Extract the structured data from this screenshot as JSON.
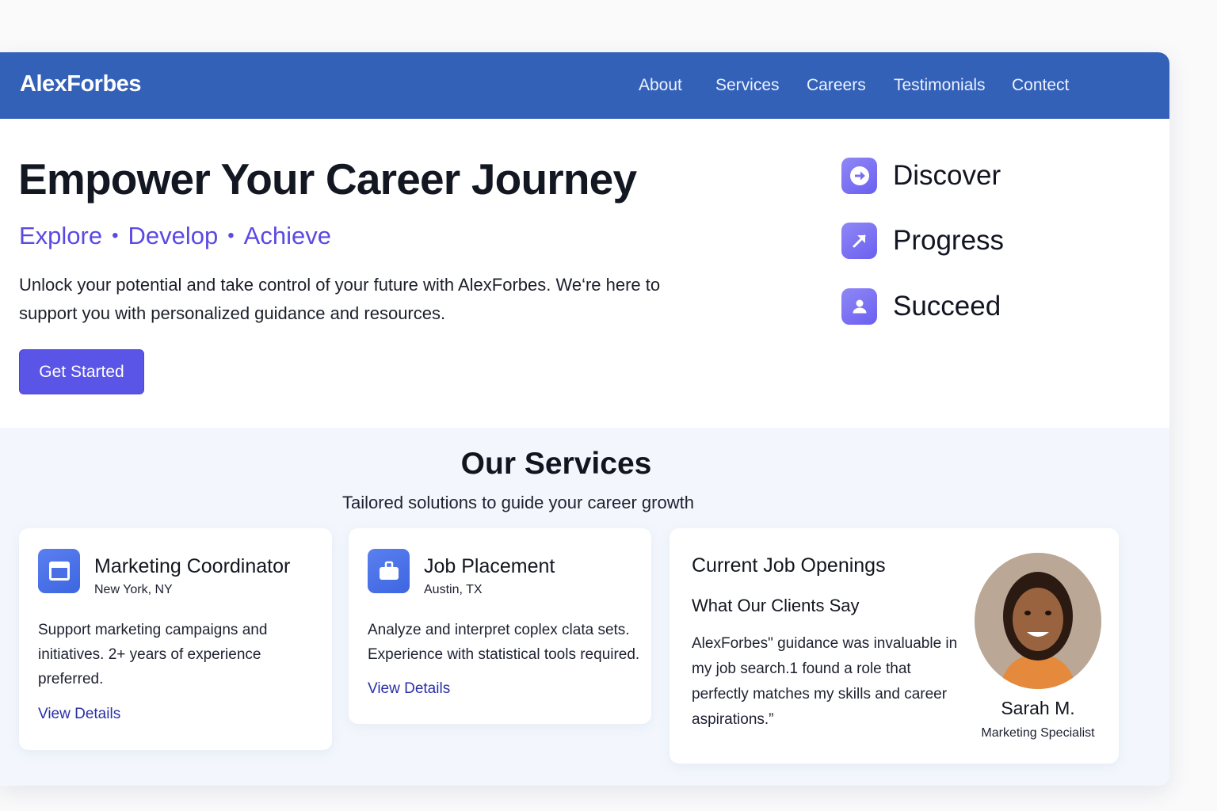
{
  "brand": {
    "name": "AlexForbes"
  },
  "nav": {
    "items": [
      {
        "label": "About"
      },
      {
        "label": "Services"
      },
      {
        "label": "Careers"
      },
      {
        "label": "Testimonials"
      },
      {
        "label": "Contect"
      }
    ]
  },
  "hero": {
    "title": "Empower Your Career Journey",
    "tagline": [
      "Explore",
      "Develop",
      "Achieve"
    ],
    "tagline_separator": "•",
    "description": "Unlock your potential and take control of your future with AlexForbes. We‘re here to support you with personalized guidance and resources.",
    "cta_label": "Get Started"
  },
  "steps": [
    {
      "label": "Discover",
      "icon": "arrow-right-icon"
    },
    {
      "label": "Progress",
      "icon": "arrow-up-right-icon"
    },
    {
      "label": "Succeed",
      "icon": "user-icon"
    }
  ],
  "services": {
    "title": "Our Services",
    "subtitle": "Tailored solutions to guide your career growth",
    "cards": [
      {
        "icon": "browser-window-icon",
        "title": "Marketing Coordinator",
        "location": "New York, NY",
        "description": "Support marketing campaigns and initiatives. 2+ years of experience preferred.",
        "link": "View Details"
      },
      {
        "icon": "briefcase-icon",
        "title": "Job Placement",
        "location": "Austin, TX",
        "description": "Analyze and interpret coplex clata sets. Experience with statistical tools required.",
        "link": "View Details"
      }
    ],
    "openings": {
      "title": "Current Job Openings",
      "testimonial_heading": "What Our Clients Say",
      "quote": "AlexForbes\" guidance was invaluable in my job search.1 found a role that perfectly matches my skills and career aspirations.”",
      "name": "Sarah M.",
      "role": "Marketing Specialist"
    }
  },
  "colors": {
    "nav_bg": "#3361b8",
    "accent": "#5a4ae3",
    "button": "#5a55e6",
    "link": "#2a2fa8",
    "services_bg": "#f3f7fd"
  }
}
